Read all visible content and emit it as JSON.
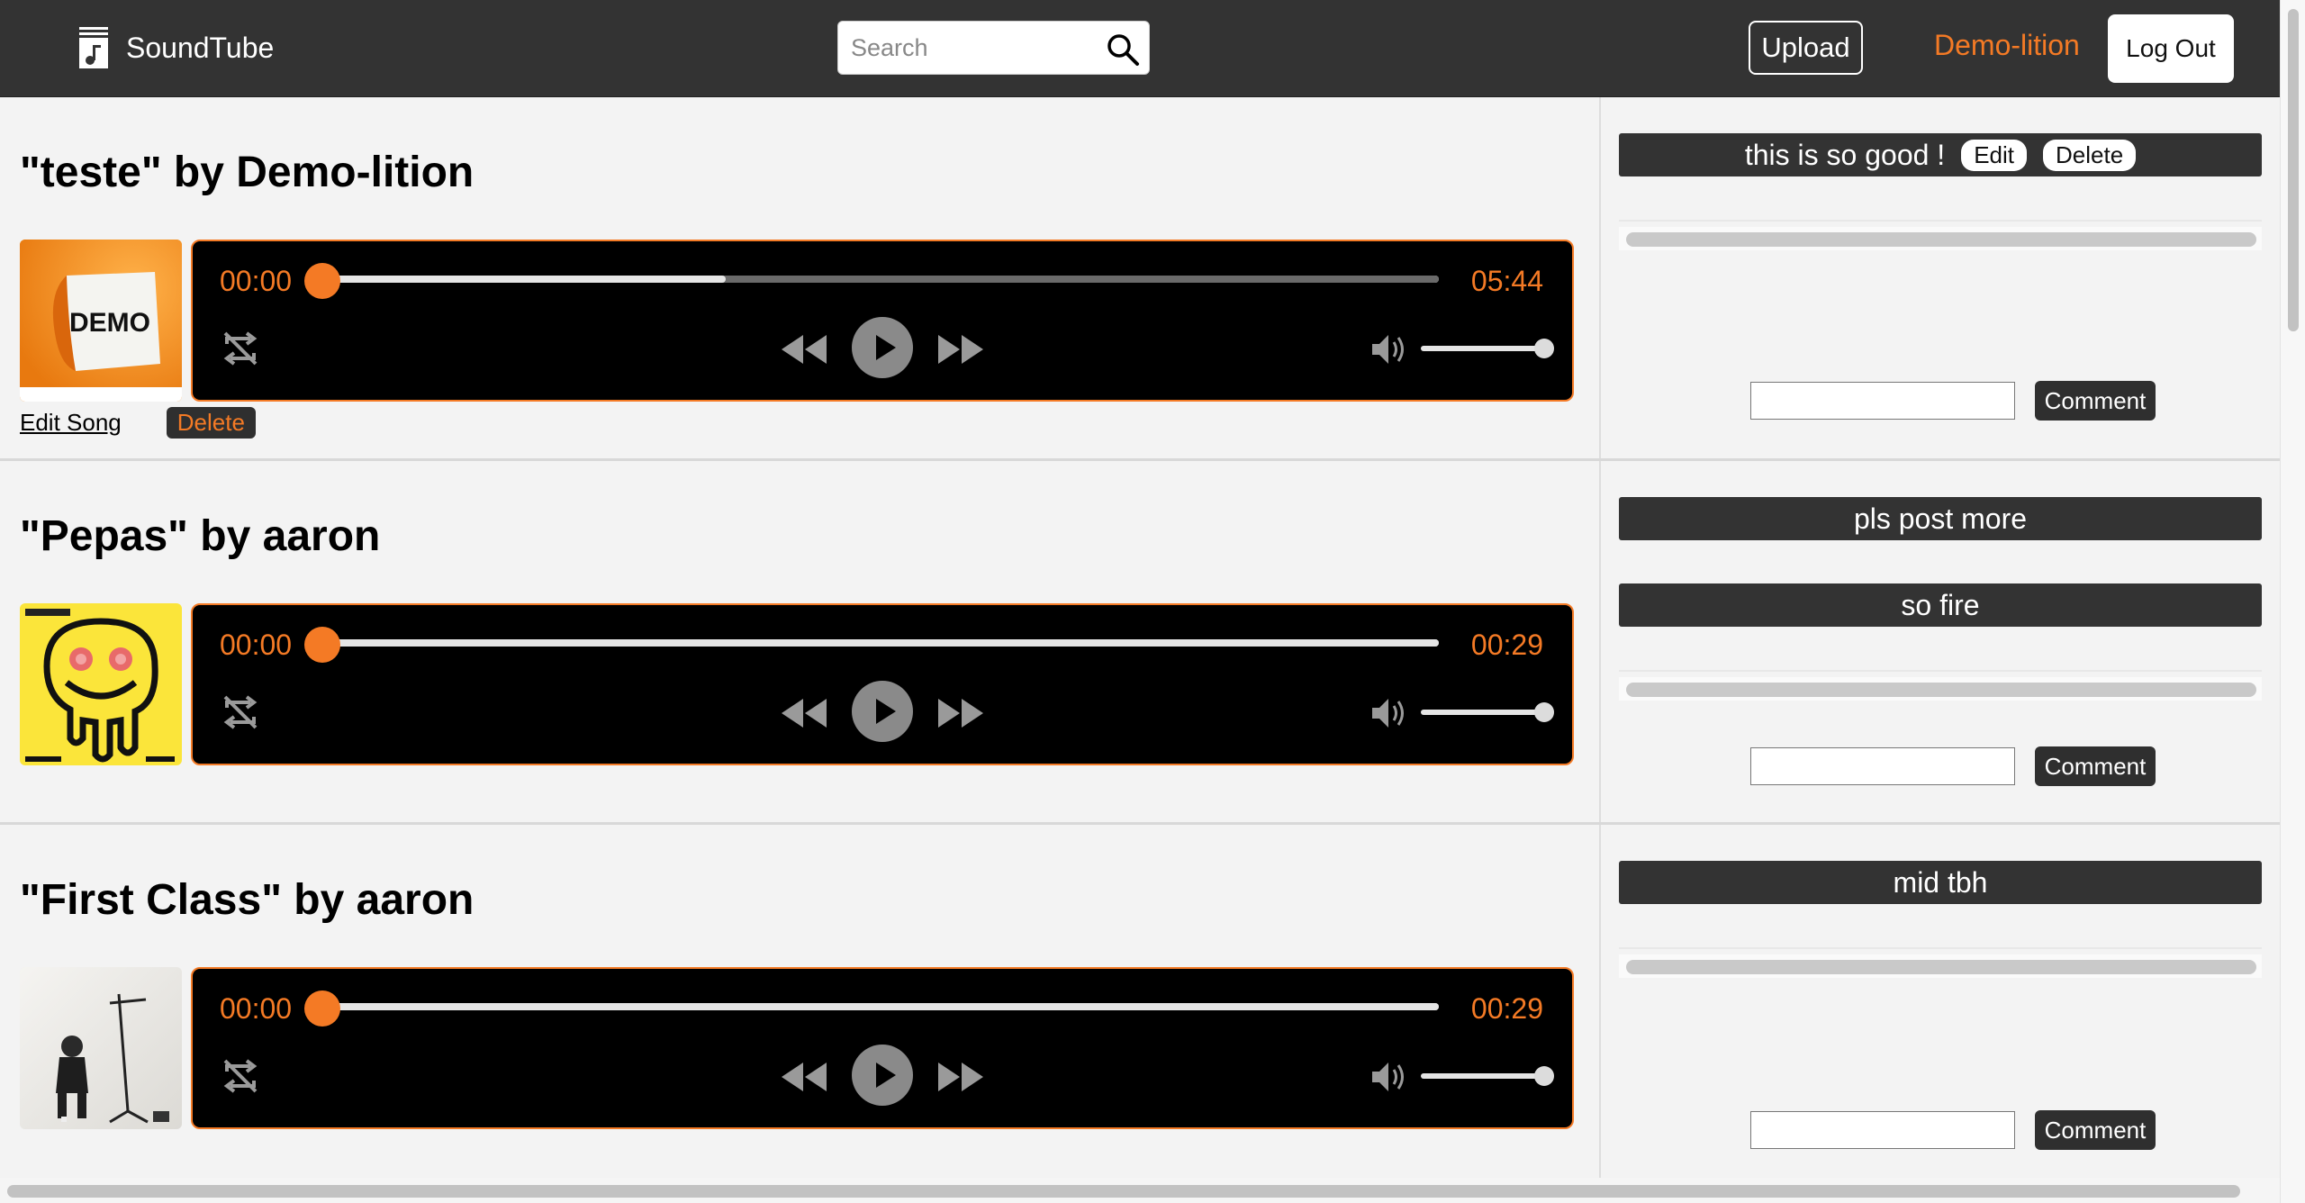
{
  "header": {
    "brand": "SoundTube",
    "search_placeholder": "Search",
    "upload_label": "Upload",
    "username": "Demo-lition",
    "logout_label": "Log Out"
  },
  "colors": {
    "accent": "#f47a25",
    "header_bg": "#333333",
    "player_bg": "#000000"
  },
  "songs": [
    {
      "title": "\"teste\" by Demo-lition",
      "current_time": "00:00",
      "duration": "05:44",
      "buffered_fraction": 0.36,
      "volume_fraction": 1.0,
      "owner_actions": {
        "edit": "Edit Song",
        "delete": "Delete"
      },
      "comments": [
        {
          "text": "this is so good !",
          "edit": "Edit",
          "delete": "Delete"
        }
      ],
      "comment_button": "Comment"
    },
    {
      "title": "\"Pepas\" by aaron",
      "current_time": "00:00",
      "duration": "00:29",
      "buffered_fraction": 1.0,
      "volume_fraction": 1.0,
      "comments": [
        {
          "text": "pls post more"
        },
        {
          "text": "so fire"
        }
      ],
      "comment_button": "Comment"
    },
    {
      "title": "\"First Class\" by aaron",
      "current_time": "00:00",
      "duration": "00:29",
      "buffered_fraction": 1.0,
      "volume_fraction": 1.0,
      "comments": [
        {
          "text": "mid tbh"
        }
      ],
      "comment_button": "Comment"
    }
  ],
  "icons": {
    "brand": "music-note-icon",
    "search": "search-icon",
    "loop": "loop-off-icon",
    "rewind": "rewind-icon",
    "play": "play-icon",
    "forward": "fast-forward-icon",
    "volume": "volume-icon"
  }
}
